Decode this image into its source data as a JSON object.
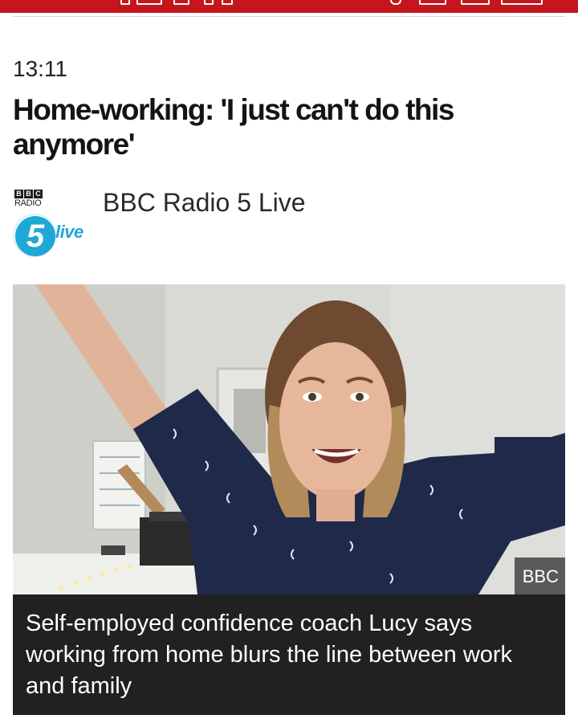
{
  "status_bar": {
    "background": "#c4161c",
    "icons": [
      "signal-icon",
      "wifi-icon",
      "battery-icon",
      "clock-icon"
    ]
  },
  "article": {
    "time": "13:11",
    "headline": "Home-working: 'I just can't do this anymore'"
  },
  "source": {
    "logo_bbc": [
      "B",
      "B",
      "C"
    ],
    "logo_radio": "RADIO",
    "logo_five": "5",
    "logo_live": "live",
    "name": "BBC Radio 5 Live"
  },
  "media": {
    "image": "woman-arms-raised-photo",
    "credit": "BBC",
    "caption": "Self-employed confidence coach Lucy says working from home blurs the line between work and family"
  },
  "colors": {
    "accent": "#c4161c",
    "five_live_blue": "#1fa8d6",
    "caption_bg": "#212121"
  }
}
